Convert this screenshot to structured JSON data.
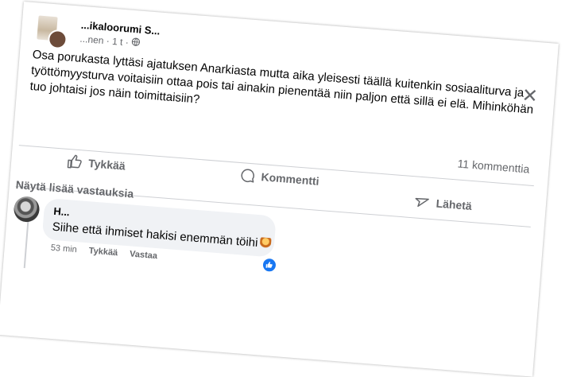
{
  "post": {
    "group_name": "...ikaloorumi S...",
    "meta_author": "...nen",
    "meta_time": "1 t",
    "meta_sep": "·",
    "body": "Osa porukasta lyttäsi ajatuksen Anarkiasta mutta aika yleisesti täällä kuitenkin sosiaaliturva ja työttömyysturva voitaisiin ottaa pois tai ainakin pienentää niin paljon että sillä ei elä. Mihinköhän tuo johtaisi jos näin toimittaisiin?",
    "more_icon": "···",
    "close_icon": "✕",
    "comment_count": "11 kommenttia"
  },
  "actions": {
    "like": "Tykkää",
    "comment": "Kommentti",
    "share": "Lähetä"
  },
  "comments": {
    "more_replies": "Näytä lisää vastauksia",
    "items": [
      {
        "author": "H...",
        "text": "Siihe että ihmiset hakisi enemmän töihi",
        "time": "53 min",
        "like_label": "Tykkää",
        "reply_label": "Vastaa"
      }
    ]
  },
  "colors": {
    "accent": "#1877f2",
    "muted": "#65676b",
    "bubble": "#f0f2f5"
  },
  "icons": [
    "like-icon",
    "comment-icon",
    "share-icon",
    "globe-icon",
    "close-icon",
    "more-icon"
  ]
}
